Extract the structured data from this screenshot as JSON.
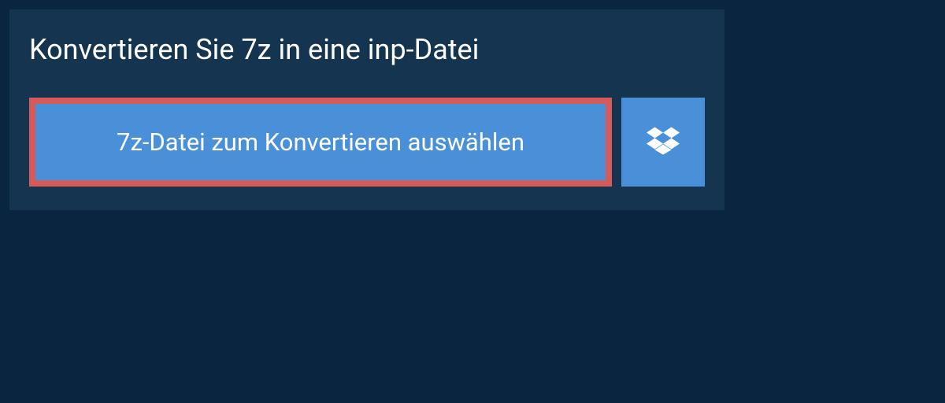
{
  "heading": "Konvertieren Sie 7z in eine inp-Datei",
  "buttons": {
    "select_file": "7z-Datei zum Konvertieren auswählen"
  }
}
